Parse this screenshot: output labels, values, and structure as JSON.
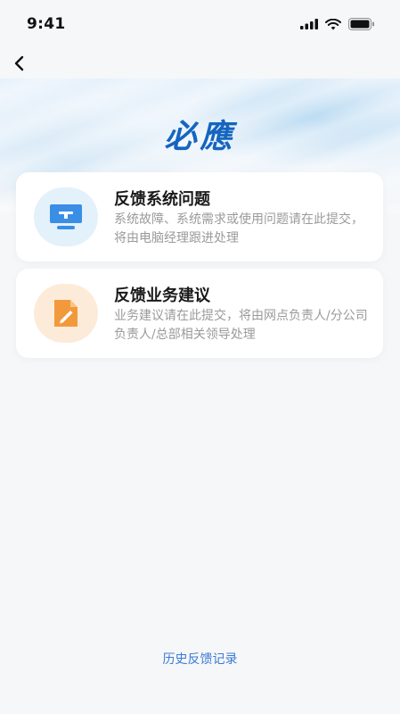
{
  "status_bar": {
    "time": "9:41"
  },
  "header": {
    "logo_text": "必應"
  },
  "cards": [
    {
      "title": "反馈系统问题",
      "description": "系统故障、系统需求或使用问题请在此提交，将由电脑经理跟进处理",
      "icon": "monitor-icon",
      "icon_color": "#3a8ee6"
    },
    {
      "title": "反馈业务建议",
      "description": "业务建议请在此提交，将由网点负责人/分公司负责人/总部相关领导处理",
      "icon": "document-edit-icon",
      "icon_color": "#f29a3b"
    }
  ],
  "footer": {
    "history_link": "历史反馈记录"
  },
  "colors": {
    "accent": "#3a7bd5",
    "logo": "#1565c0"
  }
}
